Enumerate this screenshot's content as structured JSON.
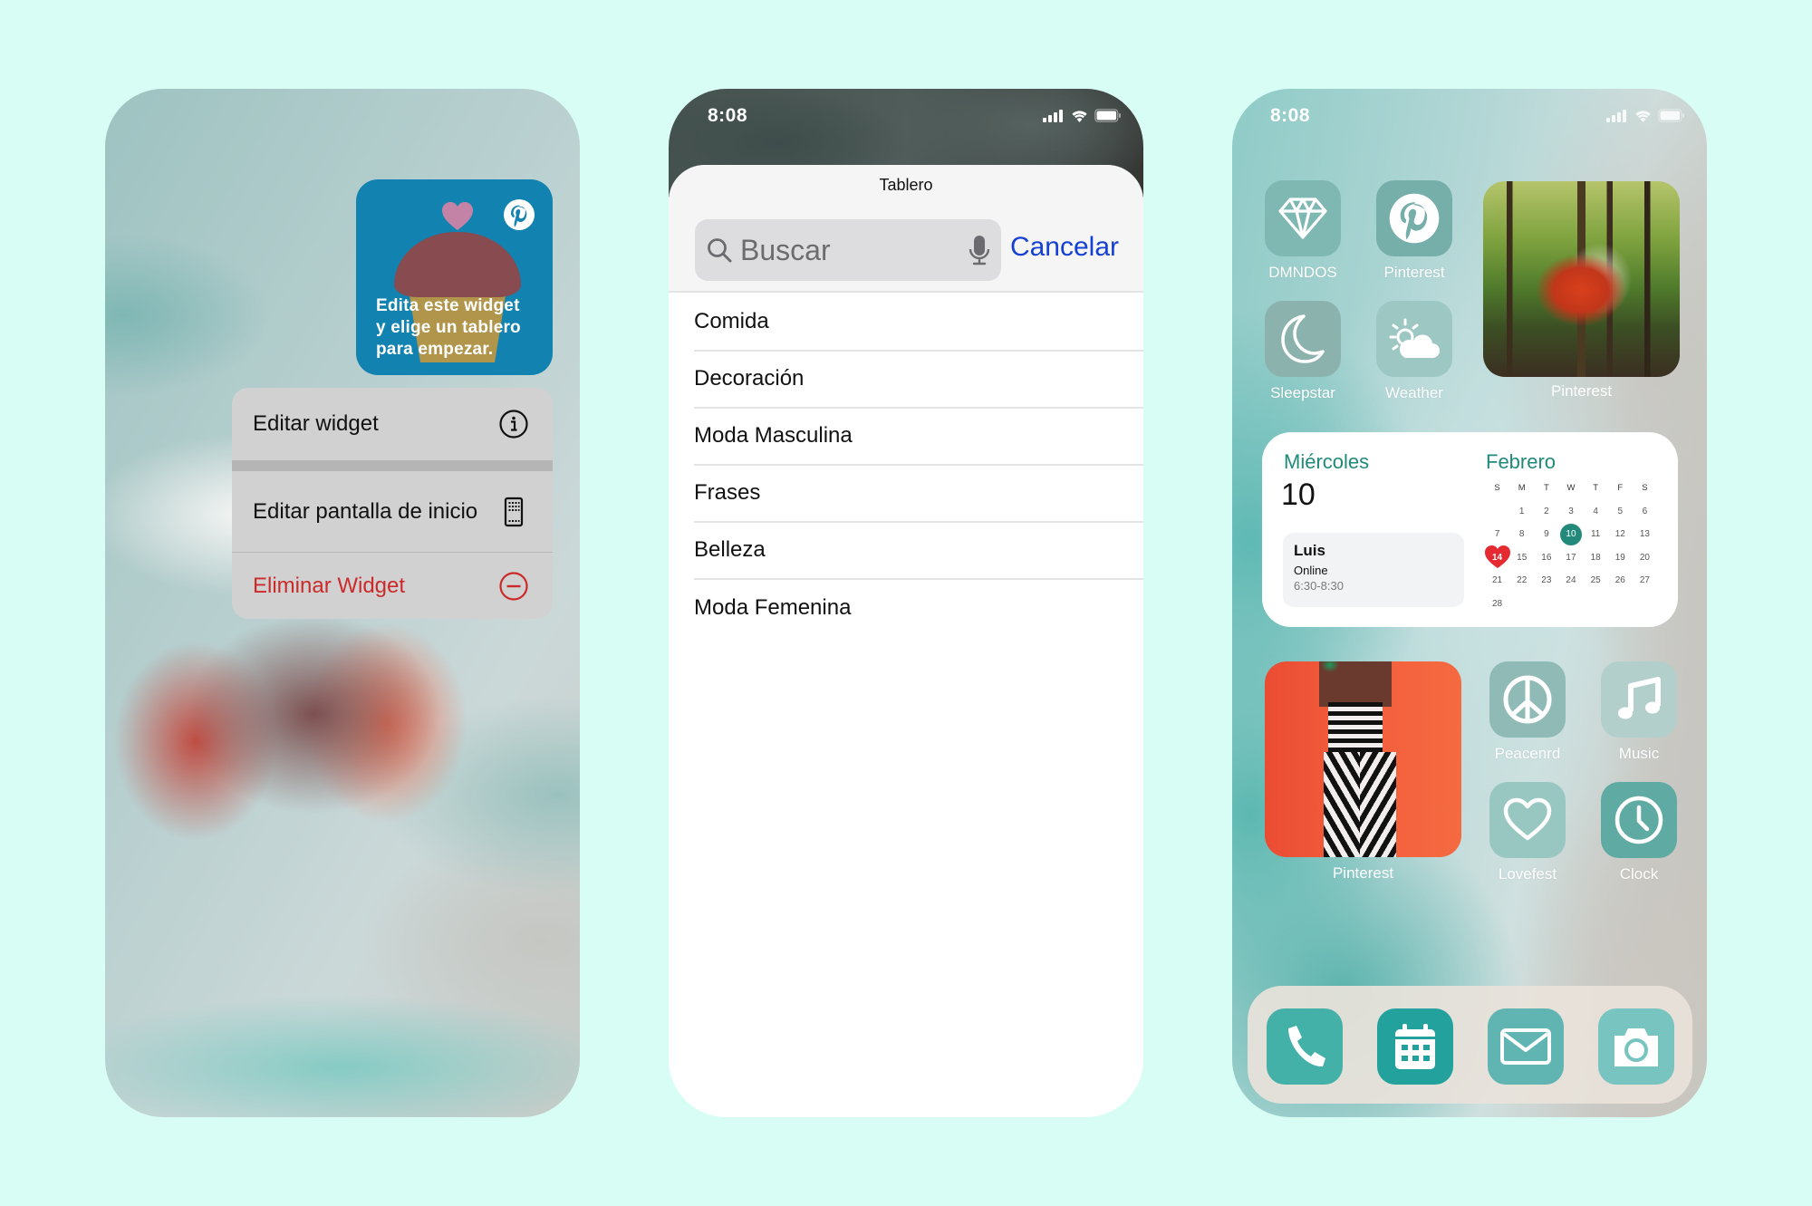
{
  "colors": {
    "page_background": "#d8fdf4",
    "pinterest_widget_blue": "#1283b0",
    "destructive_red": "#cc2a2a",
    "ios_link_blue": "#1540d4",
    "calendar_teal": "#1f8a7a",
    "today_circle": "#23897a",
    "heart_red": "#e62a32"
  },
  "left_phone": {
    "widget": {
      "brand_icon": "pinterest-logo-icon",
      "illustration": "cupcake-with-heart",
      "message_lines": [
        "Edita este widget",
        "y elige un tablero",
        "para empezar."
      ]
    },
    "context_menu": {
      "items": [
        {
          "label": "Editar widget",
          "icon": "info-circle-icon",
          "destructive": false
        },
        {
          "label": "Editar pantalla de inicio",
          "icon": "phone-grid-icon",
          "destructive": false
        },
        {
          "label": "Eliminar Widget",
          "icon": "minus-circle-icon",
          "destructive": true
        }
      ]
    }
  },
  "middle_phone": {
    "status_bar": {
      "time": "8:08",
      "icons": [
        "signal-icon",
        "wifi-icon",
        "battery-icon"
      ]
    },
    "sheet": {
      "title": "Tablero",
      "search": {
        "placeholder": "Buscar",
        "value": "",
        "left_icon": "search-icon",
        "right_icon": "microphone-icon"
      },
      "cancel_label": "Cancelar",
      "boards": [
        "Comida",
        "Decoración",
        "Moda Masculina",
        "Frases",
        "Belleza",
        "Moda Femenina"
      ]
    }
  },
  "right_phone": {
    "status_bar": {
      "time": "8:08",
      "icons": [
        "signal-icon",
        "wifi-icon",
        "battery-icon"
      ]
    },
    "apps": [
      {
        "label": "DMNDOS",
        "icon": "diamond-icon"
      },
      {
        "label": "Pinterest",
        "icon": "pinterest-logo-icon"
      },
      {
        "label": "Sleepstar",
        "icon": "moon-icon"
      },
      {
        "label": "Weather",
        "icon": "sun-cloud-icon"
      },
      {
        "label": "Peacenrd",
        "icon": "peace-sign-icon"
      },
      {
        "label": "Music",
        "icon": "music-note-icon"
      },
      {
        "label": "Lovefest",
        "icon": "heart-icon"
      },
      {
        "label": "Clock",
        "icon": "clock-icon"
      }
    ],
    "photo_widgets": [
      {
        "label": "Pinterest",
        "subject": "red armchair in forest"
      },
      {
        "label": "Pinterest",
        "subject": "striped dress on orange background"
      }
    ],
    "calendar_widget": {
      "weekday": "Miércoles",
      "day": "10",
      "event": {
        "title": "Luis",
        "subtitle": "Online",
        "time": "6:30-8:30"
      },
      "month": "Febrero",
      "weekday_headers": [
        "S",
        "M",
        "T",
        "W",
        "T",
        "F",
        "S"
      ],
      "leading_blanks": 1,
      "days_in_month": 28,
      "today": 10,
      "highlighted_heart_day": 14
    },
    "dock": [
      {
        "name": "Phone",
        "icon": "phone-icon"
      },
      {
        "name": "Calendar",
        "icon": "calendar-icon"
      },
      {
        "name": "Mail",
        "icon": "mail-icon"
      },
      {
        "name": "Camera",
        "icon": "camera-icon"
      }
    ]
  }
}
